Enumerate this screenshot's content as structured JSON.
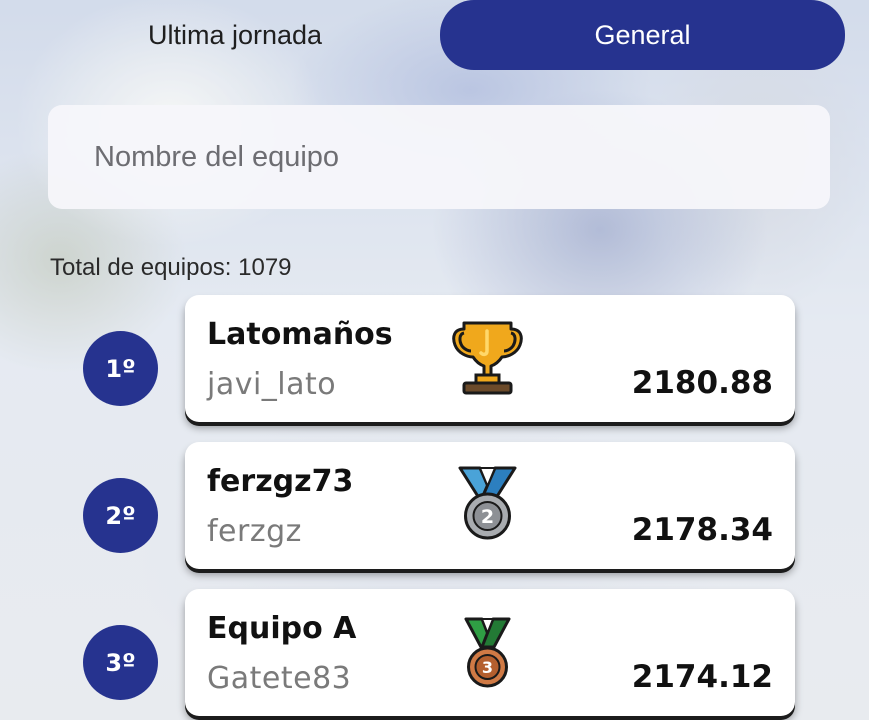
{
  "tabs": {
    "ultima_jornada": "Ultima jornada",
    "general": "General",
    "active": "general"
  },
  "search": {
    "placeholder": "Nombre del equipo",
    "value": ""
  },
  "total": {
    "text": "Total de equipos: 1079"
  },
  "ranking": [
    {
      "position": "1º",
      "team": "Latomaños",
      "user": "javi_lato",
      "points": "2180.88",
      "award_icon": "trophy-icon"
    },
    {
      "position": "2º",
      "team": "ferzgz73",
      "user": "ferzgz",
      "points": "2178.34",
      "award_icon": "silver-medal-icon"
    },
    {
      "position": "3º",
      "team": "Equipo A",
      "user": "Gatete83",
      "points": "2174.12",
      "award_icon": "bronze-medal-icon"
    }
  ],
  "colors": {
    "accent": "#26338f",
    "card": "#ffffff",
    "gold": "#f0a81c",
    "silver": "#a9acb0",
    "bronze": "#d07a45"
  }
}
